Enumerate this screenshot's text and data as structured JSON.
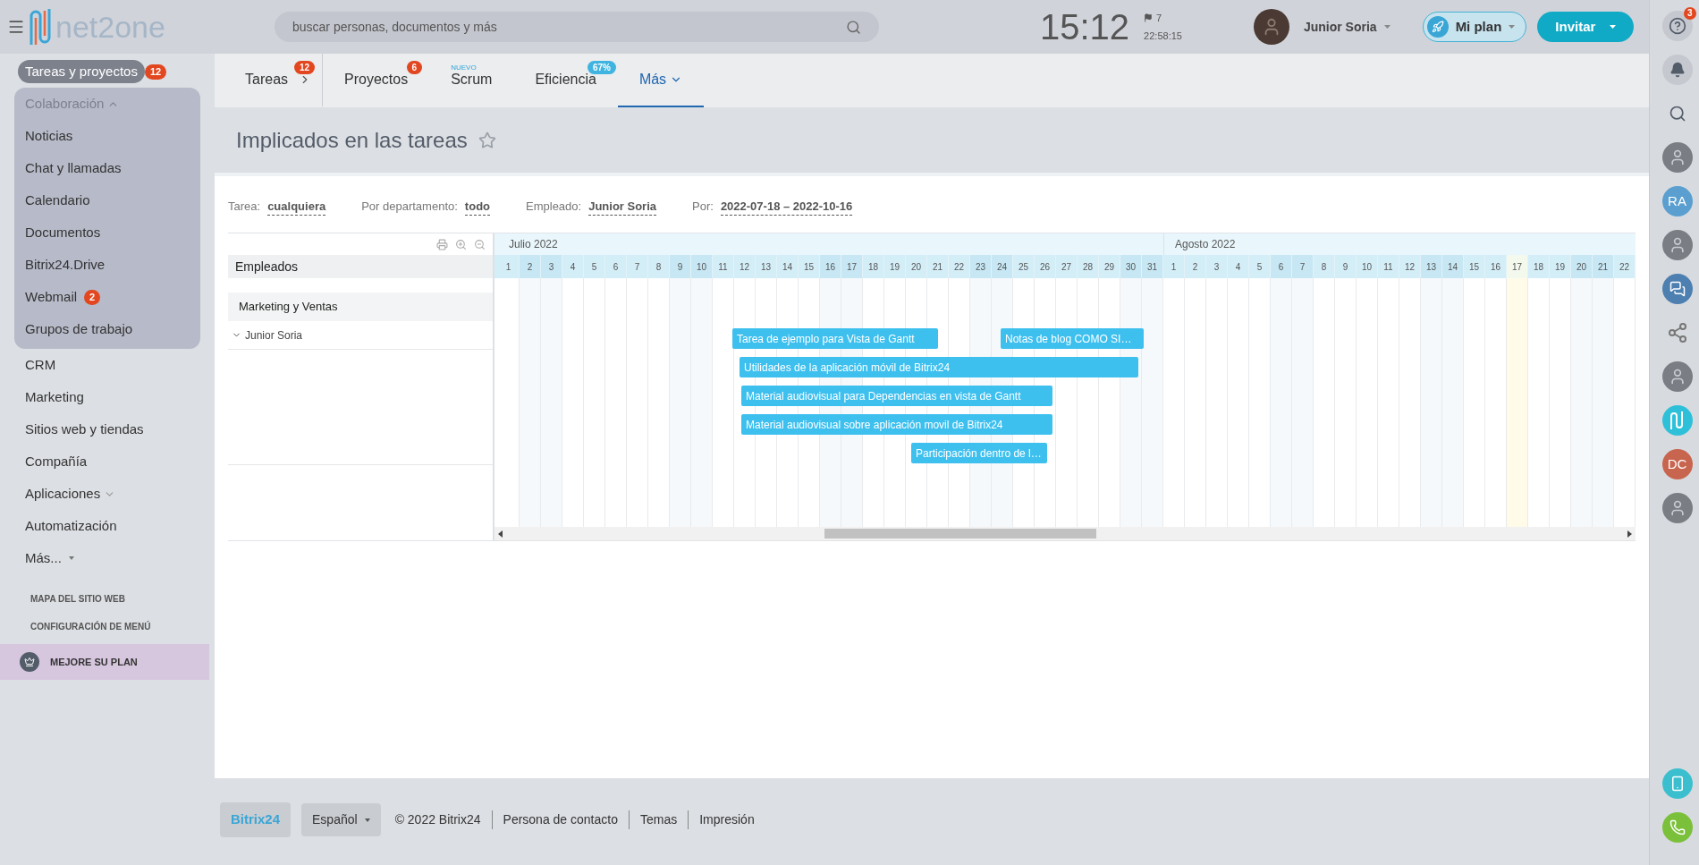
{
  "top_bar": {
    "logo": "net2one",
    "search": {
      "placeholder": "buscar personas, documentos y más"
    },
    "clock": "15:12",
    "flag_count": "7",
    "timer": "22:58:15",
    "user": "Junior Soria",
    "plan_button": "Mi plan",
    "invite_button": "Invitar"
  },
  "sidebar": {
    "items": [
      {
        "kind": "link",
        "label": "Tareas y proyectos",
        "badge": "12",
        "selected": true
      },
      {
        "kind": "group",
        "label": "Colaboración",
        "expanded": true,
        "selected": false,
        "children": [
          {
            "kind": "link",
            "label": "Noticias",
            "selected": false
          },
          {
            "kind": "link",
            "label": "Chat y llamadas",
            "selected": false
          },
          {
            "kind": "link",
            "label": "Calendario",
            "selected": false
          },
          {
            "kind": "link",
            "label": "Documentos",
            "selected": false
          },
          {
            "kind": "link",
            "label": "Bitrix24.Drive",
            "selected": false
          },
          {
            "kind": "link",
            "label": "Webmail",
            "badge": "2",
            "selected": false
          },
          {
            "kind": "link",
            "label": "Grupos de trabajo",
            "selected": false
          }
        ]
      },
      {
        "kind": "link",
        "label": "CRM",
        "selected": false
      },
      {
        "kind": "link",
        "label": "Marketing",
        "selected": false
      },
      {
        "kind": "link",
        "label": "Sitios web y tiendas",
        "selected": false
      },
      {
        "kind": "link",
        "label": "Compañía",
        "selected": false
      },
      {
        "kind": "group",
        "label": "Aplicaciones",
        "expanded": false,
        "selected": false
      },
      {
        "kind": "link",
        "label": "Automatización",
        "selected": false
      },
      {
        "kind": "more",
        "label": "Más...",
        "selected": false
      }
    ],
    "links": [
      "MAPA DEL SITIO WEB",
      "CONFIGURACIÓN DE MENÚ"
    ],
    "upgrade": "MEJORE SU PLAN"
  },
  "tabs": [
    {
      "kind": "count",
      "label": "Tareas",
      "badge": "12",
      "arrow": true,
      "selected": false
    },
    {
      "kind": "count",
      "label": "Proyectos",
      "badge": "6",
      "arrow": false,
      "selected": false
    },
    {
      "kind": "new",
      "label": "Scrum",
      "badge": "NUEVO",
      "arrow": false,
      "selected": false
    },
    {
      "kind": "percent",
      "label": "Eficiencia",
      "badge": "67%",
      "arrow": false,
      "selected": false
    },
    {
      "kind": "menu",
      "label": "Más",
      "arrow": false,
      "selected": true
    }
  ],
  "page_title": "Implicados en las tareas",
  "favorite": false,
  "filters": [
    {
      "label": "Tarea:",
      "value": "cualquiera"
    },
    {
      "label": "Por departamento:",
      "value": "todo"
    },
    {
      "label": "Empleado:",
      "value": "Junior Soria"
    },
    {
      "label": "Por:",
      "value": "2022-07-18 – 2022-10-16"
    }
  ],
  "gantt": {
    "employees_header": "Empleados",
    "department": "Marketing y Ventas",
    "employee": {
      "name": "Junior Soria",
      "expanded": true
    },
    "months": [
      {
        "label": "Julio 2022",
        "days": [
          {
            "label": "1",
            "weekend": false,
            "today": false
          },
          {
            "label": "2",
            "weekend": true,
            "today": false
          },
          {
            "label": "3",
            "weekend": true,
            "today": false
          },
          {
            "label": "4",
            "weekend": false,
            "today": false
          },
          {
            "label": "5",
            "weekend": false,
            "today": false
          },
          {
            "label": "6",
            "weekend": false,
            "today": false
          },
          {
            "label": "7",
            "weekend": false,
            "today": false
          },
          {
            "label": "8",
            "weekend": false,
            "today": false
          },
          {
            "label": "9",
            "weekend": true,
            "today": false
          },
          {
            "label": "10",
            "weekend": true,
            "today": false
          },
          {
            "label": "11",
            "weekend": false,
            "today": false
          },
          {
            "label": "12",
            "weekend": false,
            "today": false
          },
          {
            "label": "13",
            "weekend": false,
            "today": false
          },
          {
            "label": "14",
            "weekend": false,
            "today": false
          },
          {
            "label": "15",
            "weekend": false,
            "today": false
          },
          {
            "label": "16",
            "weekend": true,
            "today": false
          },
          {
            "label": "17",
            "weekend": true,
            "today": false
          },
          {
            "label": "18",
            "weekend": false,
            "today": false
          },
          {
            "label": "19",
            "weekend": false,
            "today": false
          },
          {
            "label": "20",
            "weekend": false,
            "today": false
          },
          {
            "label": "21",
            "weekend": false,
            "today": false
          },
          {
            "label": "22",
            "weekend": false,
            "today": false
          },
          {
            "label": "23",
            "weekend": true,
            "today": false
          },
          {
            "label": "24",
            "weekend": true,
            "today": false
          },
          {
            "label": "25",
            "weekend": false,
            "today": false
          },
          {
            "label": "26",
            "weekend": false,
            "today": false
          },
          {
            "label": "27",
            "weekend": false,
            "today": false
          },
          {
            "label": "28",
            "weekend": false,
            "today": false
          },
          {
            "label": "29",
            "weekend": false,
            "today": false
          },
          {
            "label": "30",
            "weekend": true,
            "today": false
          },
          {
            "label": "31",
            "weekend": true,
            "today": false
          }
        ]
      },
      {
        "label": "Agosto 2022",
        "days": [
          {
            "label": "1",
            "weekend": false,
            "today": false
          },
          {
            "label": "2",
            "weekend": false,
            "today": false
          },
          {
            "label": "3",
            "weekend": false,
            "today": false
          },
          {
            "label": "4",
            "weekend": false,
            "today": false
          },
          {
            "label": "5",
            "weekend": false,
            "today": false
          },
          {
            "label": "6",
            "weekend": true,
            "today": false
          },
          {
            "label": "7",
            "weekend": true,
            "today": false
          },
          {
            "label": "8",
            "weekend": false,
            "today": false
          },
          {
            "label": "9",
            "weekend": false,
            "today": false
          },
          {
            "label": "10",
            "weekend": false,
            "today": false
          },
          {
            "label": "11",
            "weekend": false,
            "today": false
          },
          {
            "label": "12",
            "weekend": false,
            "today": false
          },
          {
            "label": "13",
            "weekend": true,
            "today": false
          },
          {
            "label": "14",
            "weekend": true,
            "today": false
          },
          {
            "label": "15",
            "weekend": false,
            "today": false
          },
          {
            "label": "16",
            "weekend": false,
            "today": false
          },
          {
            "label": "17",
            "weekend": false,
            "today": true
          },
          {
            "label": "18",
            "weekend": false,
            "today": false
          },
          {
            "label": "19",
            "weekend": false,
            "today": false
          },
          {
            "label": "20",
            "weekend": true,
            "today": false
          },
          {
            "label": "21",
            "weekend": true,
            "today": false
          },
          {
            "label": "22",
            "weekend": false,
            "today": false
          }
        ]
      }
    ],
    "tasks": [
      {
        "label": "Tarea de ejemplo para Vista de Gantt"
      },
      {
        "label": "Notas de blog COMO SI…"
      },
      {
        "label": "Utilidades de la aplicación móvil de Bitrix24"
      },
      {
        "label": "Material audiovisual para Dependencias en vista de Gantt"
      },
      {
        "label": "Material audiovisual sobre aplicación movil de Bitrix24"
      },
      {
        "label": "Participación dentro de l…"
      }
    ]
  },
  "footer": {
    "brand": "Bitrix24",
    "language": "Español",
    "copyright": "© 2022 Bitrix24",
    "links": [
      "Persona de contacto",
      "Temas",
      "Impresión"
    ]
  },
  "right_rail": [
    {
      "kind": "help",
      "badge": "3"
    },
    {
      "kind": "bell"
    },
    {
      "kind": "search"
    },
    {
      "kind": "photo"
    },
    {
      "kind": "initials",
      "text": "RA",
      "color": "#5a9fd0"
    },
    {
      "kind": "photo"
    },
    {
      "kind": "chat"
    },
    {
      "kind": "network"
    },
    {
      "kind": "photo"
    },
    {
      "kind": "logo"
    },
    {
      "kind": "initials",
      "text": "DC",
      "color": "#c8654f"
    },
    {
      "kind": "photo"
    },
    {
      "kind": "device"
    },
    {
      "kind": "phone"
    }
  ]
}
